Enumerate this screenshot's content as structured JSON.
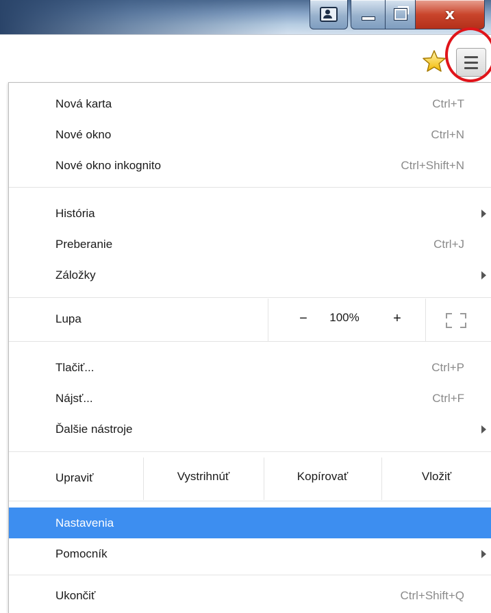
{
  "window": {
    "close_glyph": "x"
  },
  "menu": {
    "new_tab": {
      "label": "Nová karta",
      "shortcut": "Ctrl+T"
    },
    "new_window": {
      "label": "Nové okno",
      "shortcut": "Ctrl+N"
    },
    "incognito": {
      "label": "Nové okno inkognito",
      "shortcut": "Ctrl+Shift+N"
    },
    "history": {
      "label": "História"
    },
    "downloads": {
      "label": "Preberanie",
      "shortcut": "Ctrl+J"
    },
    "bookmarks": {
      "label": "Záložky"
    },
    "zoom": {
      "label": "Lupa",
      "minus": "−",
      "value": "100%",
      "plus": "+"
    },
    "print": {
      "label": "Tlačiť...",
      "shortcut": "Ctrl+P"
    },
    "find": {
      "label": "Nájsť...",
      "shortcut": "Ctrl+F"
    },
    "more_tools": {
      "label": "Ďalšie nástroje"
    },
    "edit": {
      "label": "Upraviť",
      "cut": "Vystrihnúť",
      "copy": "Kopírovať",
      "paste": "Vložiť"
    },
    "settings": {
      "label": "Nastavenia"
    },
    "help": {
      "label": "Pomocník"
    },
    "exit": {
      "label": "Ukončiť",
      "shortcut": "Ctrl+Shift+Q"
    }
  },
  "colors": {
    "highlight": "#3d8ef0",
    "annotation_circle": "#e0141a"
  },
  "icons": {
    "bookmark": "star-icon",
    "menu": "hamburger-menu-icon",
    "fullscreen": "fullscreen-icon"
  }
}
